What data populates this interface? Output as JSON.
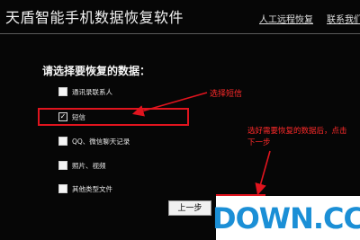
{
  "app": {
    "title": "天盾智能手机数据恢复软件",
    "links": {
      "remote_support": "人工远程恢复",
      "contact": "联系我们"
    }
  },
  "main": {
    "heading": "请选择要恢复的数据：",
    "options": [
      {
        "label": "通讯录联系人",
        "checked": false
      },
      {
        "label": "短信",
        "checked": true
      },
      {
        "label": "QQ、微信聊天记录",
        "checked": false
      },
      {
        "label": "照片、视频",
        "checked": false
      },
      {
        "label": "其他类型文件",
        "checked": false
      }
    ],
    "prev_button": "上一步"
  },
  "annotations": {
    "select_sms": "选择短信",
    "after_select": "选好需要恢复的数据后，点击下一步"
  },
  "watermark": {
    "text": "DOWN.CC"
  },
  "colors": {
    "annotation_red": "#e0141e",
    "watermark_blue": "#1b8fd6"
  }
}
